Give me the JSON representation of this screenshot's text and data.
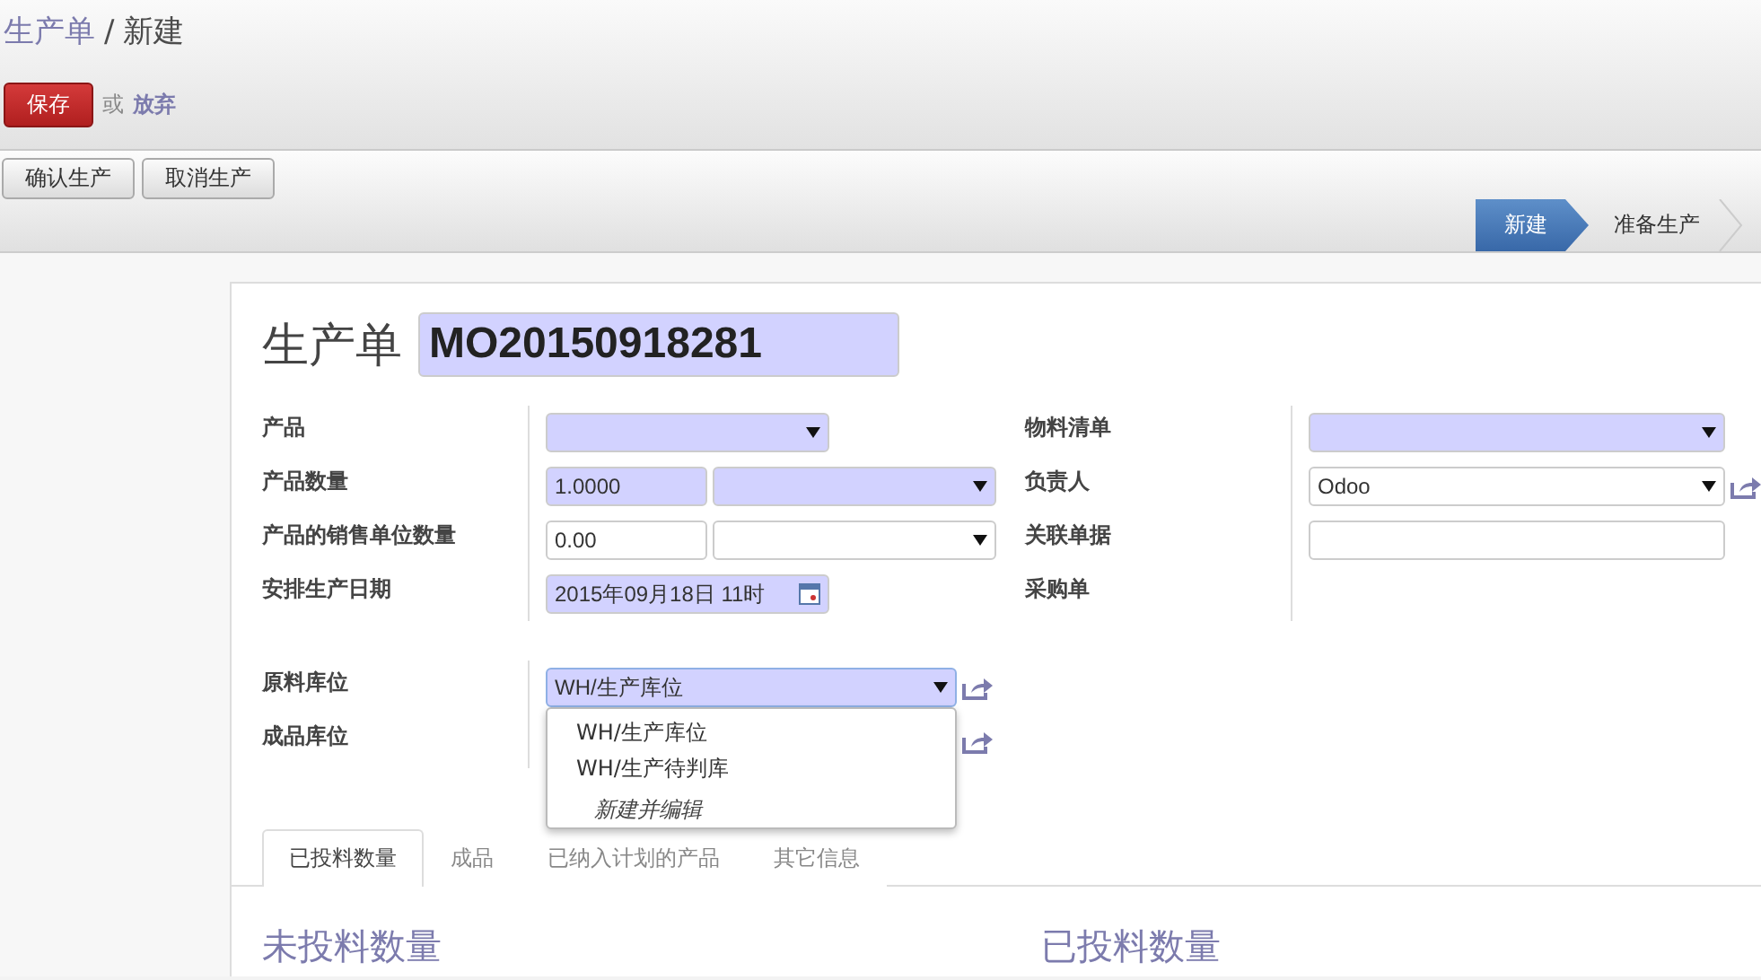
{
  "breadcrumb": {
    "parent": "生产单",
    "separator": "/",
    "current": "新建"
  },
  "actions": {
    "save": "保存",
    "or": "或",
    "discard": "放弃"
  },
  "buttons": [
    "确认生产",
    "取消生产"
  ],
  "statusbar": [
    {
      "label": "新建",
      "selected": true
    },
    {
      "label": "准备生产",
      "selected": false
    }
  ],
  "form": {
    "title": "生产单",
    "name": "MO20150918281",
    "left_fields": [
      {
        "label": "产品",
        "inputs": [
          {
            "kind": "select",
            "required": true
          }
        ]
      },
      {
        "label": "产品数量",
        "inputs": [
          {
            "kind": "text",
            "value": "1.0000",
            "required": true
          },
          {
            "kind": "select",
            "required": true
          }
        ]
      },
      {
        "label": "产品的销售单位数量",
        "inputs": [
          {
            "kind": "text",
            "value": "0.00",
            "required": false
          },
          {
            "kind": "select",
            "required": false
          }
        ]
      },
      {
        "label": "安排生产日期",
        "inputs": [
          {
            "kind": "date",
            "value": "2015年09月18日 11时",
            "required": true
          }
        ]
      }
    ],
    "right_fields": [
      {
        "label": "物料清单",
        "inputs": [
          {
            "kind": "select",
            "required": true
          }
        ]
      },
      {
        "label": "负责人",
        "link": true,
        "inputs": [
          {
            "kind": "select",
            "value": "Odoo",
            "required": false
          }
        ]
      },
      {
        "label": "关联单据",
        "inputs": [
          {
            "kind": "text",
            "required": false
          }
        ]
      },
      {
        "label": "采购单"
      }
    ],
    "location_fields": [
      {
        "label": "原料库位",
        "link": true,
        "inputs": [
          {
            "kind": "select",
            "value": "WH/生产库位",
            "required": true
          }
        ]
      },
      {
        "label": "成品库位",
        "link": true
      }
    ],
    "dropdown": {
      "options": [
        "WH/生产库位",
        "WH/生产待判库"
      ],
      "create": "新建并编辑"
    },
    "tabs": [
      {
        "label": "已投料数量",
        "selected": true
      },
      {
        "label": "成品",
        "selected": false
      },
      {
        "label": "已纳入计划的产品",
        "selected": false
      },
      {
        "label": "其它信息",
        "selected": false
      }
    ],
    "sections": [
      "未投料数量",
      "已投料数量"
    ]
  }
}
